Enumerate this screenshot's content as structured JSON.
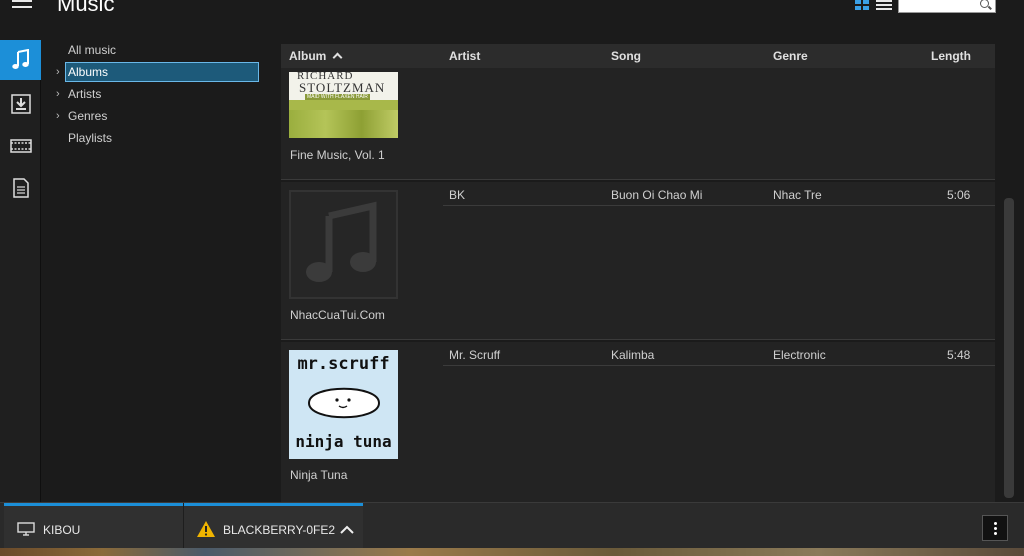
{
  "header": {
    "title": "Music"
  },
  "rail": {
    "items": [
      "music-icon",
      "download-icon",
      "video-icon",
      "document-icon"
    ],
    "active": "music-icon"
  },
  "tree": {
    "items": [
      {
        "label": "All music",
        "expandable": false,
        "selected": false
      },
      {
        "label": "Albums",
        "expandable": true,
        "selected": true
      },
      {
        "label": "Artists",
        "expandable": true,
        "selected": false
      },
      {
        "label": "Genres",
        "expandable": true,
        "selected": false
      },
      {
        "label": "Playlists",
        "expandable": false,
        "selected": false
      }
    ]
  },
  "table": {
    "columns": {
      "album": "Album",
      "artist": "Artist",
      "song": "Song",
      "genre": "Genre",
      "length": "Length"
    },
    "groups": [
      {
        "album": "Fine Music, Vol. 1",
        "cover_text_1": "RICHARD",
        "cover_text_2": "STOLTZMAN",
        "cover_text_3": "MAID WITH FLAXEN HAIR",
        "tracks": []
      },
      {
        "album": "NhacCuaTui.Com",
        "tracks": [
          {
            "artist": "BK",
            "song": "Buon Oi Chao Mi",
            "genre": "Nhac Tre",
            "length": "5:06"
          }
        ]
      },
      {
        "album": "Ninja Tuna",
        "cover_text_1": "mr.scruff",
        "cover_text_2": "ninja tuna",
        "tracks": [
          {
            "artist": "Mr. Scruff",
            "song": "Kalimba",
            "genre": "Electronic",
            "length": "5:48"
          }
        ]
      }
    ]
  },
  "taskbar": {
    "tasks": [
      {
        "label": "KIBOU"
      },
      {
        "label": "BLACKBERRY-0FE2"
      }
    ]
  },
  "colors": {
    "accent": "#1c8fd8",
    "warning": "#f0b400"
  }
}
